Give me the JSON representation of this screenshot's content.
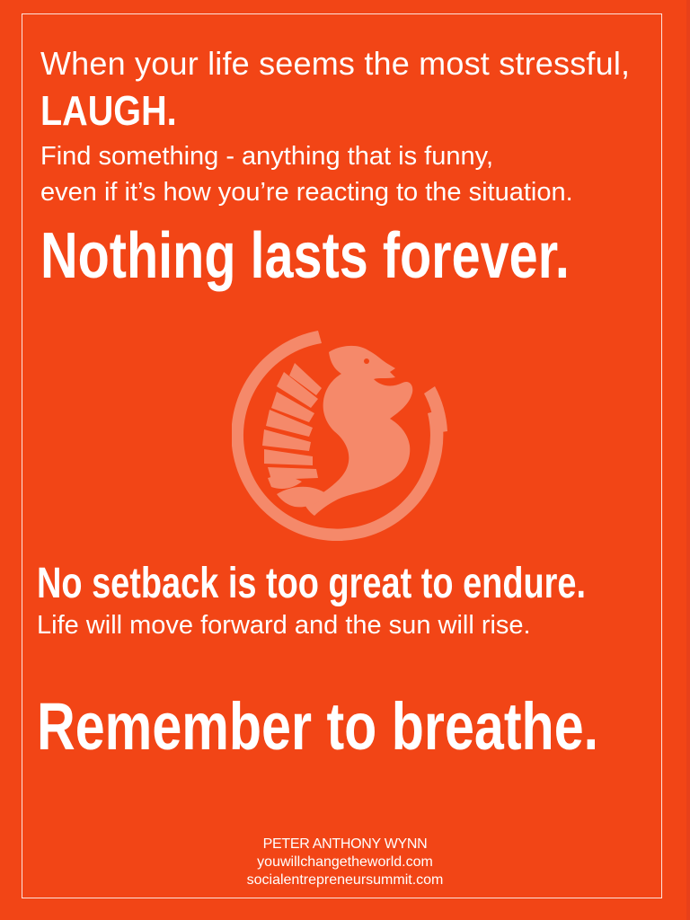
{
  "quote": {
    "line1": "When your life seems the most stressful,",
    "laugh": "LAUGH.",
    "find_line1": "Find something - anything that is funny,",
    "find_line2": "even if it’s how you’re reacting to the situation.",
    "nothing": "Nothing lasts forever.",
    "setback": "No setback is too great to endure.",
    "life": "Life will move forward and the sun will rise.",
    "remember": "Remember to breathe."
  },
  "credits": {
    "author": "PETER ANTHONY WYNN",
    "site1": "youwillchangetheworld.com",
    "site2": "socialentrepreneursummit.com"
  },
  "colors": {
    "background": "#f24516",
    "text": "#ffffff",
    "emblem": "#f5896a"
  },
  "emblem": {
    "icon": "phoenix-emblem-icon"
  }
}
